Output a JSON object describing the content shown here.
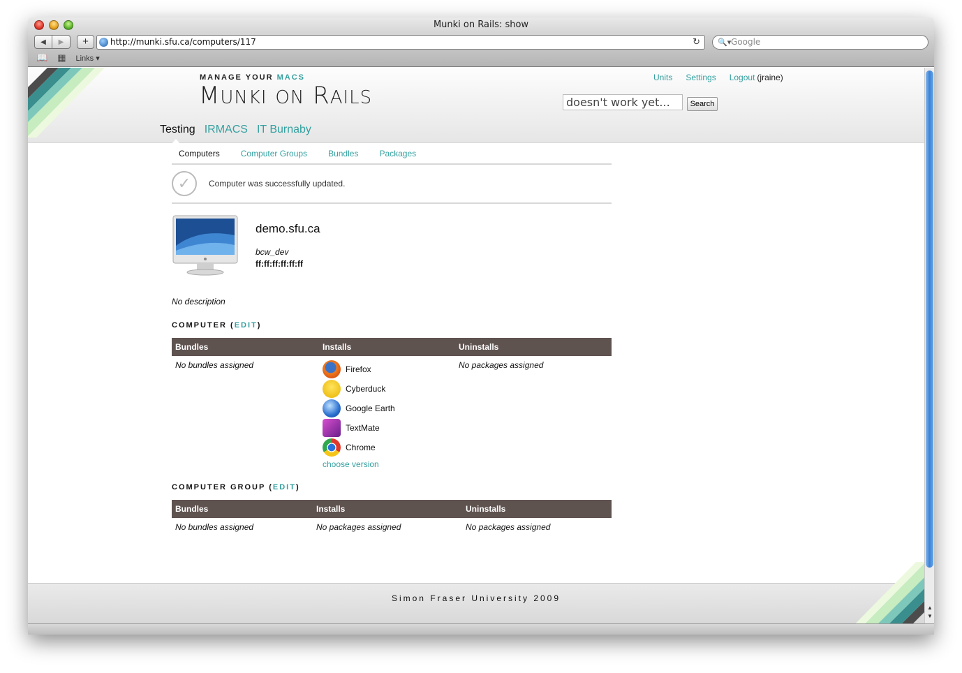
{
  "window": {
    "title": "Munki on Rails: show"
  },
  "browser": {
    "url": "http://munki.sfu.ca/computers/117",
    "search_placeholder": "Google",
    "bookmarks_label": "Links"
  },
  "header": {
    "tagline_prefix": "MANAGE YOUR",
    "tagline_accent": "MACS",
    "logo_m": "M",
    "logo_unki": "UNKI",
    "logo_on": "ON",
    "logo_r": "R",
    "logo_ails": "AILS",
    "links": {
      "units": "Units",
      "settings": "Settings",
      "logout": "Logout",
      "user": "(jraine)"
    },
    "search_value": "doesn't work yet...",
    "search_button": "Search",
    "unit_tabs": [
      "Testing",
      "IRMACS",
      "IT Burnaby"
    ]
  },
  "subnav": [
    "Computers",
    "Computer Groups",
    "Bundles",
    "Packages"
  ],
  "flash": {
    "message": "Computer was successfully updated."
  },
  "computer": {
    "name": "demo.sfu.ca",
    "user": "bcw_dev",
    "mac": "ff:ff:ff:ff:ff:ff",
    "description": "No description"
  },
  "computer_section": {
    "heading": "COMPUTER",
    "edit": "EDIT",
    "columns": [
      "Bundles",
      "Installs",
      "Uninstalls"
    ],
    "bundles_empty": "No bundles assigned",
    "installs": [
      {
        "name": "Firefox",
        "icon": "firefox-icon"
      },
      {
        "name": "Cyberduck",
        "icon": "cyberduck-icon"
      },
      {
        "name": "Google Earth",
        "icon": "google-earth-icon"
      },
      {
        "name": "TextMate",
        "icon": "textmate-icon"
      },
      {
        "name": "Chrome",
        "icon": "chrome-icon"
      }
    ],
    "choose_version": "choose version",
    "uninstalls_empty": "No packages assigned"
  },
  "group_section": {
    "heading": "COMPUTER GROUP",
    "edit": "EDIT",
    "columns": [
      "Bundles",
      "Installs",
      "Uninstalls"
    ],
    "bundles_empty": "No bundles assigned",
    "installs_empty": "No packages assigned",
    "uninstalls_empty": "No packages assigned"
  },
  "footer": {
    "text": "Simon Fraser University 2009"
  },
  "colors": {
    "accent": "#35a0a0",
    "table_header": "#5f5350"
  }
}
